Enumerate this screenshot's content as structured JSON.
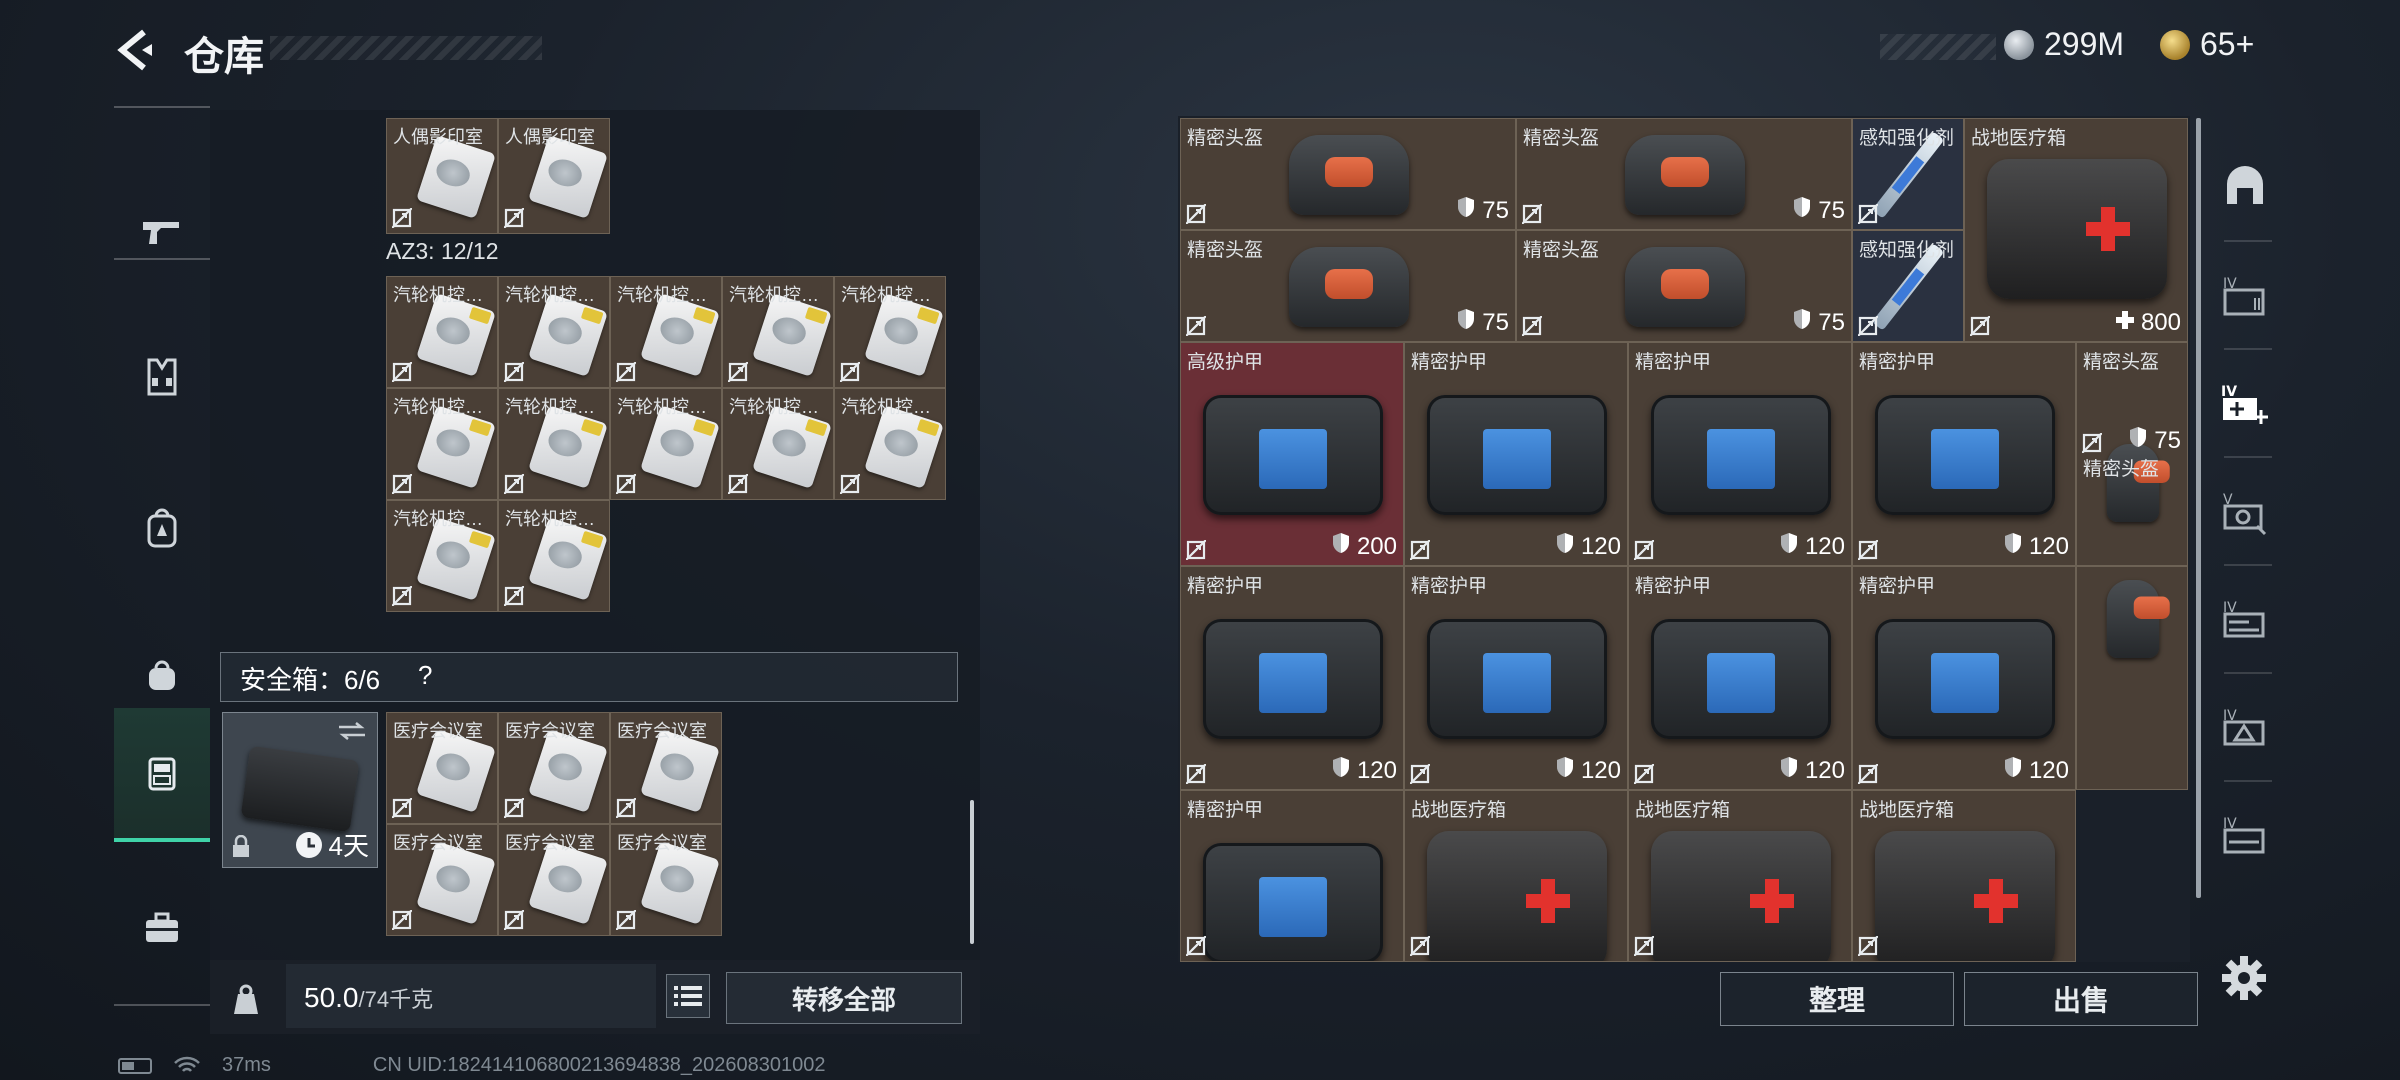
{
  "header": {
    "title": "仓库",
    "currencies": [
      {
        "icon": "silver-coin-icon",
        "value": "299M"
      },
      {
        "icon": "gold-coin-icon",
        "value": "65+"
      }
    ]
  },
  "nav": {
    "items": [
      {
        "icon": "gun-icon",
        "name": "weapons"
      },
      {
        "icon": "vest-icon",
        "name": "chest-rig"
      },
      {
        "icon": "backpack-icon",
        "name": "backpack"
      },
      {
        "icon": "pouch-icon",
        "name": "pouch"
      },
      {
        "icon": "safe-case-icon",
        "name": "safe-box",
        "active": true
      },
      {
        "icon": "toolbox-icon",
        "name": "toolbox"
      }
    ]
  },
  "left": {
    "top_items": [
      {
        "label": "人偶影印室"
      },
      {
        "label": "人偶影印室"
      }
    ],
    "az3_label": "AZ3: 12/12",
    "az3_items": [
      "汽轮机控…",
      "汽轮机控…",
      "汽轮机控…",
      "汽轮机控…",
      "汽轮机控…",
      "汽轮机控…",
      "汽轮机控…",
      "汽轮机控…",
      "汽轮机控…",
      "汽轮机控…",
      "汽轮机控…",
      "汽轮机控…"
    ],
    "safe_title": "安全箱：6/6",
    "safe_help": "?",
    "safe_timer": "4天",
    "safe_items": [
      "医疗会议室",
      "医疗会议室",
      "医疗会议室",
      "医疗会议室",
      "医疗会议室",
      "医疗会议室"
    ],
    "weight_value": "50.0",
    "weight_max": "/74千克",
    "transfer_label": "转移全部"
  },
  "right": {
    "items": [
      {
        "label": "精密头盔",
        "value": "75",
        "kind": "helmet"
      },
      {
        "label": "精密头盔",
        "value": "75",
        "kind": "helmet"
      },
      {
        "label": "感知强化剂",
        "value": "",
        "kind": "syringe"
      },
      {
        "label": "战地医疗箱",
        "value": "800",
        "kind": "medkit"
      },
      {
        "label": "精密头盔",
        "value": "75",
        "kind": "helmet"
      },
      {
        "label": "精密头盔",
        "value": "75",
        "kind": "helmet"
      },
      {
        "label": "感知强化剂",
        "value": "",
        "kind": "syringe"
      },
      {
        "label": "高级护甲",
        "value": "200",
        "kind": "armor"
      },
      {
        "label": "精密护甲",
        "value": "120",
        "kind": "armor"
      },
      {
        "label": "精密护甲",
        "value": "120",
        "kind": "armor"
      },
      {
        "label": "精密护甲",
        "value": "120",
        "kind": "armor"
      },
      {
        "label": "精密头盔",
        "value": "75",
        "kind": "helmet-side"
      },
      {
        "label": "精密护甲",
        "value": "120",
        "kind": "armor"
      },
      {
        "label": "精密护甲",
        "value": "120",
        "kind": "armor"
      },
      {
        "label": "精密护甲",
        "value": "120",
        "kind": "armor"
      },
      {
        "label": "精密护甲",
        "value": "120",
        "kind": "armor"
      },
      {
        "label": "精密头盔",
        "value": "",
        "kind": "helmet-side"
      },
      {
        "label": "精密护甲",
        "value": "",
        "kind": "armor"
      },
      {
        "label": "战地医疗箱",
        "value": "",
        "kind": "medkit"
      },
      {
        "label": "战地医疗箱",
        "value": "",
        "kind": "medkit"
      },
      {
        "label": "战地医疗箱",
        "value": "",
        "kind": "medkit"
      }
    ],
    "sort_label": "整理",
    "sell_label": "出售",
    "tabs": [
      "helmet-arch-icon",
      "storage-4-icon",
      "storage-add-icon",
      "storage-5-icon",
      "storage-4b-icon",
      "storage-4c-icon",
      "storage-4d-icon"
    ]
  },
  "status": {
    "ping": "37ms",
    "uid": "CN UID:18241410680021369483​8_202608301002"
  }
}
